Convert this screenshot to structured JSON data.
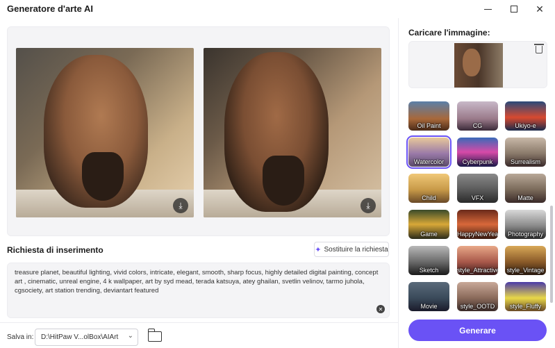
{
  "window": {
    "title": "Generatore d'arte AI"
  },
  "preview": {
    "download_hint": ""
  },
  "prompt": {
    "title": "Richiesta di inserimento",
    "replace_label": "Sostituire la richiesta",
    "text": "treasure planet, beautiful lighting, vivid colors, intricate, elegant, smooth, sharp focus, highly detailed digital painting, concept art , cinematic, unreal engine, 4 k wallpaper, art by syd mead, terada katsuya, atey ghailan, svetlin velinov, tarmo juhola, cgsociety, art station trending, deviantart featured"
  },
  "save": {
    "label": "Salva in:",
    "path": "D:\\HitPaw V...olBox\\AIArt"
  },
  "upload": {
    "title": "Caricare l'immagine:"
  },
  "styles": [
    {
      "label": "Oil Paint",
      "bg": "linear-gradient(180deg,#5b7fa8,#a8683a 60%,#4a2a18)"
    },
    {
      "label": "CG",
      "bg": "linear-gradient(180deg,#c8b8c8,#9a7a8a 60%,#3a2a38)"
    },
    {
      "label": "Ukiyo-e",
      "bg": "linear-gradient(180deg,#2a4a7a,#d84a30 55%,#1a2a4a)"
    },
    {
      "label": "Watercolor",
      "bg": "linear-gradient(180deg,#e8c89a,#9a7aa8 55%,#5a4a6a)",
      "selected": true
    },
    {
      "label": "Cyberpunk",
      "bg": "linear-gradient(180deg,#3a6ab8,#d84aa8 50%,#1a1a4a)"
    },
    {
      "label": "Surrealism",
      "bg": "linear-gradient(180deg,#c8b8a8,#8a7a6a 55%,#3a2a2a)"
    },
    {
      "label": "Child",
      "bg": "linear-gradient(180deg,#f0c878,#c89a48 55%,#6a4a28)"
    },
    {
      "label": "VFX",
      "bg": "linear-gradient(180deg,#8a8a8a,#5a5a5a 55%,#2a2a2a)"
    },
    {
      "label": "Matte",
      "bg": "linear-gradient(180deg,#b8a898,#7a6a5a 55%,#3a2a28)"
    },
    {
      "label": "Game",
      "bg": "linear-gradient(180deg,#3a4a2a,#d8a838 50%,#2a2a1a)"
    },
    {
      "label": "HappyNewYear",
      "bg": "linear-gradient(180deg,#6a2a1a,#d8683a 50%,#3a1a10)"
    },
    {
      "label": "Photography",
      "bg": "linear-gradient(180deg,#d8d8d8,#8a8a8a 55%,#2a2a2a)"
    },
    {
      "label": "Sketch",
      "bg": "linear-gradient(180deg,#b8b8b8,#6a6a6a 55%,#1a1a1a)"
    },
    {
      "label": "style_Attractive",
      "bg": "linear-gradient(180deg,#e8a888,#a8584a 55%,#3a1a1a)"
    },
    {
      "label": "style_Vintage",
      "bg": "linear-gradient(180deg,#d8a858,#8a5a28 55%,#2a1a10)"
    },
    {
      "label": "Movie",
      "bg": "linear-gradient(180deg,#5a6a7a,#3a4a5a 55%,#1a1a2a)"
    },
    {
      "label": "style_OOTD",
      "bg": "linear-gradient(180deg,#c8a898,#8a6a5a 55%,#3a2a28)"
    },
    {
      "label": "style_Fluffy",
      "bg": "linear-gradient(180deg,#4a3aa8,#e8d848 55%,#6a4a28)"
    }
  ],
  "generate": {
    "label": "Generare"
  }
}
